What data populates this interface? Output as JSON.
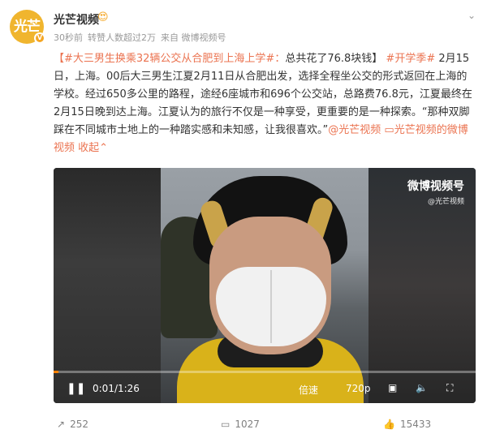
{
  "header": {
    "avatar_text": "光芒",
    "username": "光芒视频",
    "meta": {
      "time": "30秒前",
      "reposts": "转赞人数超过2万",
      "source": "来自 微博视频号"
    }
  },
  "post": {
    "topic1": "【#大三男生换乘32辆公交从合肥到上海上学#：",
    "text1": "总共花了76.8块钱】",
    "topic2": "#开学季#",
    "text2": " 2月15日，上海。00后大三男生江夏2月11日从合肥出发，选择全程坐公交的形式返回在上海的学校。经过650多公里的路程，途经6座城市和696个公交站，总路费76.8元，江夏最终在2月15日晚到达上海。江夏认为的旅行不仅是一种享受，更重要的是一种探索。“那种双脚踩在不同城市土地上的一种踏实感和未知感，让我很喜欢。”",
    "mention": "@光芒视频",
    "video_link": "光芒视频的微博视频",
    "collapse": "收起"
  },
  "video": {
    "watermark": "微博视频号",
    "watermark_sub": "@光芒视频",
    "time": "0:01/1:26",
    "progress": 0.012,
    "speed": "倍速",
    "quality": "720p"
  },
  "footer": {
    "share_count": "252",
    "comment_count": "1027",
    "like_count": "15433"
  },
  "colors": {
    "accent": "#eb7350",
    "progress": "#ff8200"
  }
}
